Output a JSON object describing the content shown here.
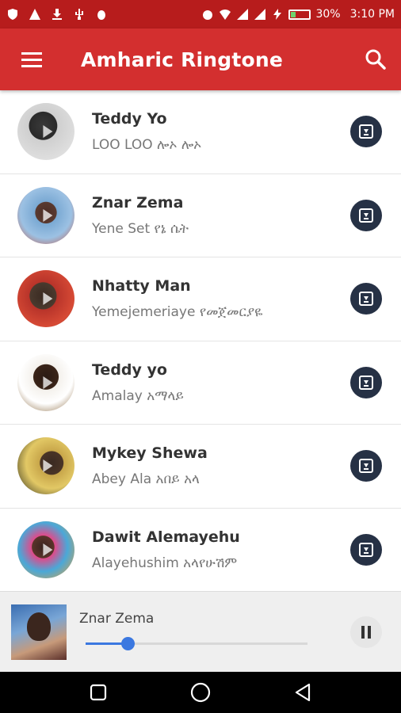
{
  "status_bar": {
    "battery": "30%",
    "battery_level": 0.3,
    "time": "3:10 PM",
    "icons": [
      "shield-icon",
      "warning-icon",
      "download-icon",
      "usb-icon",
      "bug-icon",
      "alarm-icon",
      "wifi-icon",
      "signal-icon",
      "signal-icon",
      "charging-icon"
    ]
  },
  "app_bar": {
    "title": "Amharic Ringtone",
    "background": "#d32f2f"
  },
  "songs": [
    {
      "artist": "Teddy Yo",
      "title": "LOO LOO ሎኦ ሎኦ"
    },
    {
      "artist": "Znar Zema",
      "title": "Yene Set  የኔ ሴት"
    },
    {
      "artist": "Nhatty Man",
      "title": "Yemejemeriaye የመጀመርያዬ"
    },
    {
      "artist": " Teddy yo",
      "title": "Amalay አማላይ"
    },
    {
      "artist": "Mykey Shewa",
      "title": "Abey Ala አበይ አላ"
    },
    {
      "artist": "Dawit Alemayehu",
      "title": "Alayehushim  አላየሁሽም"
    }
  ],
  "player": {
    "artist": "Znar Zema",
    "progress": 0.19,
    "accent": "#3b78e0"
  }
}
